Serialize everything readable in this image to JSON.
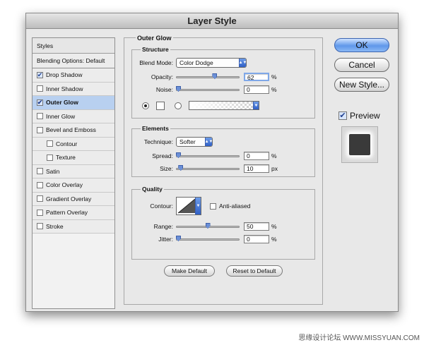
{
  "window": {
    "title": "Layer Style"
  },
  "styles_list": {
    "header": "Styles",
    "blending": "Blending Options: Default",
    "items": [
      {
        "label": "Drop Shadow",
        "checked": true,
        "selected": false,
        "indent": false
      },
      {
        "label": "Inner Shadow",
        "checked": false,
        "selected": false,
        "indent": false
      },
      {
        "label": "Outer Glow",
        "checked": true,
        "selected": true,
        "indent": false
      },
      {
        "label": "Inner Glow",
        "checked": false,
        "selected": false,
        "indent": false
      },
      {
        "label": "Bevel and Emboss",
        "checked": false,
        "selected": false,
        "indent": false
      },
      {
        "label": "Contour",
        "checked": false,
        "selected": false,
        "indent": true
      },
      {
        "label": "Texture",
        "checked": false,
        "selected": false,
        "indent": true
      },
      {
        "label": "Satin",
        "checked": false,
        "selected": false,
        "indent": false
      },
      {
        "label": "Color Overlay",
        "checked": false,
        "selected": false,
        "indent": false
      },
      {
        "label": "Gradient Overlay",
        "checked": false,
        "selected": false,
        "indent": false
      },
      {
        "label": "Pattern Overlay",
        "checked": false,
        "selected": false,
        "indent": false
      },
      {
        "label": "Stroke",
        "checked": false,
        "selected": false,
        "indent": false
      }
    ]
  },
  "outer_glow": {
    "title": "Outer Glow",
    "structure": {
      "title": "Structure",
      "blend_mode_label": "Blend Mode:",
      "blend_mode_value": "Color Dodge",
      "opacity_label": "Opacity:",
      "opacity_value": "62",
      "opacity_fraction": 0.62,
      "noise_label": "Noise:",
      "noise_value": "0",
      "noise_fraction": 0.0,
      "percent": "%"
    },
    "elements": {
      "title": "Elements",
      "technique_label": "Technique:",
      "technique_value": "Softer",
      "spread_label": "Spread:",
      "spread_value": "0",
      "spread_fraction": 0.0,
      "size_label": "Size:",
      "size_value": "10",
      "size_fraction": 0.04,
      "px": "px",
      "percent": "%"
    },
    "quality": {
      "title": "Quality",
      "contour_label": "Contour:",
      "anti_aliased_label": "Anti-aliased",
      "range_label": "Range:",
      "range_value": "50",
      "range_fraction": 0.5,
      "jitter_label": "Jitter:",
      "jitter_value": "0",
      "jitter_fraction": 0.0,
      "percent": "%"
    },
    "make_default": "Make Default",
    "reset_default": "Reset to Default"
  },
  "buttons": {
    "ok": "OK",
    "cancel": "Cancel",
    "new_style": "New Style...",
    "preview": "Preview"
  },
  "colors": {
    "accent": "#5f98ea",
    "selected_row": "#b8d0f0",
    "preview_swatch": "#3a3a3a"
  },
  "watermark": "思缘设计论坛 WWW.MISSYUAN.COM"
}
